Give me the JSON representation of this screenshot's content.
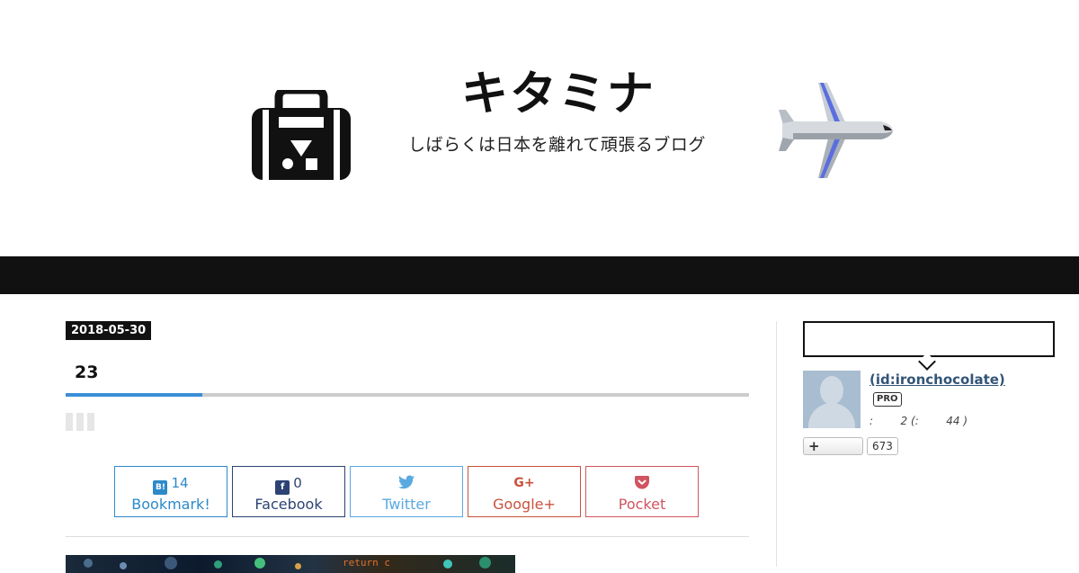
{
  "header": {
    "site_title": "キタミナ",
    "site_subtitle": "しばらくは日本を離れて頑張るブログ",
    "logo_left_icon": "suitcase-icon",
    "logo_right_icon": "airplane-icon"
  },
  "entry": {
    "date": "2018-05-30",
    "title": "23",
    "accent_color": "#3a8fd6"
  },
  "share": {
    "hatena": {
      "icon": "B!",
      "count": "14",
      "label": "Bookmark!"
    },
    "facebook": {
      "icon": "f",
      "count": "0",
      "label": "Facebook"
    },
    "twitter": {
      "icon": "twitter-bird-icon",
      "label": "Twitter"
    },
    "google": {
      "icon": "G+",
      "label": "Google+"
    },
    "pocket": {
      "icon": "pocket-icon",
      "label": "Pocket"
    }
  },
  "hero": {
    "visible_text": "return c"
  },
  "sidebar": {
    "profile": {
      "name": "(id:ironchocolate)",
      "badge": "PRO",
      "meta": ":        2 (:        44 )",
      "follow_icon": "+",
      "follow_count": "673"
    }
  },
  "colors": {
    "navbar": "#111111",
    "hatena": "#2c8ac9",
    "facebook": "#2d4373",
    "twitter": "#5aa9e0",
    "google": "#c9523d",
    "pocket": "#d05560"
  }
}
